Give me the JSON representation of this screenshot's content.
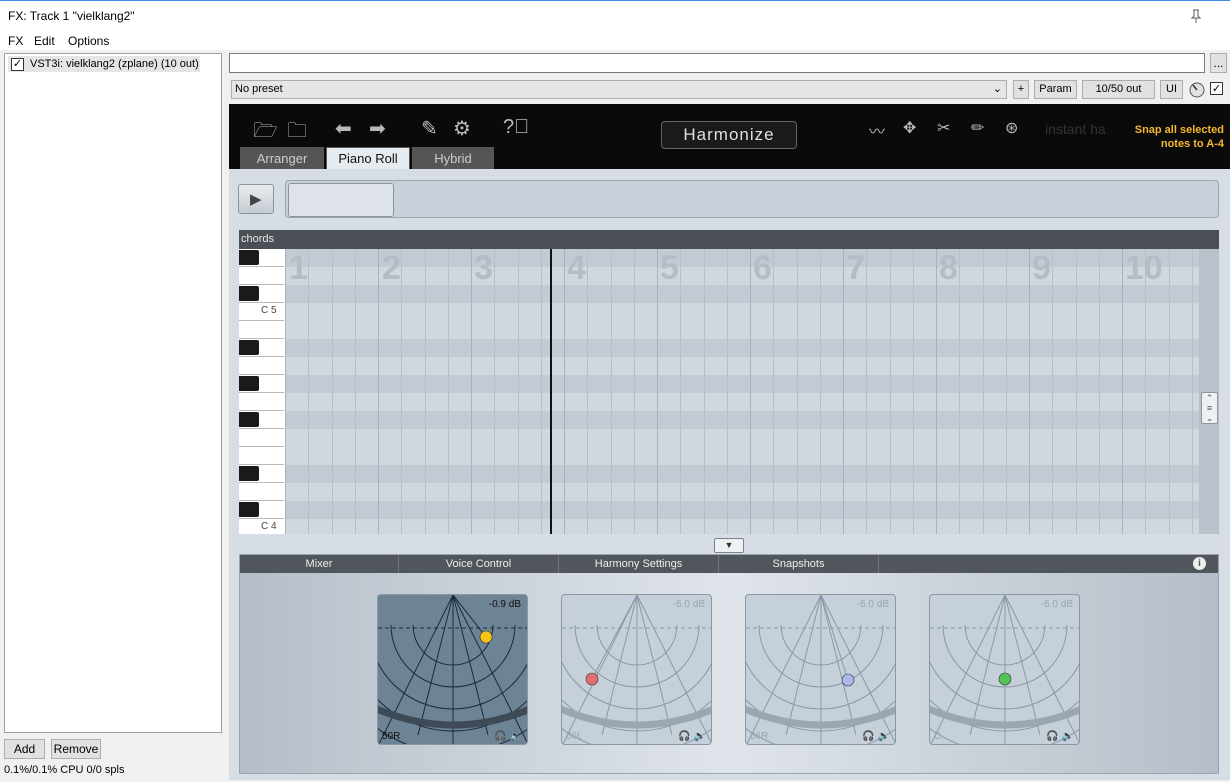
{
  "window": {
    "title": "FX: Track 1 \"vielklang2\""
  },
  "menu": {
    "items": [
      "FX",
      "Edit",
      "Options"
    ]
  },
  "fx_list": {
    "items": [
      {
        "label": "VST3i: vielklang2 (zplane) (10 out)",
        "checked": true
      }
    ],
    "add_label": "Add",
    "remove_label": "Remove",
    "cpu": "0.1%/0.1% CPU 0/0 spls"
  },
  "fx_header": {
    "name_value": "",
    "dots_label": "...",
    "preset_value": "No preset",
    "plus_label": "+",
    "param_label": "Param",
    "io_label": "10/50 out",
    "ui_label": "UI"
  },
  "plugin": {
    "toolbar_icons": [
      "folder-open-icon",
      "folder-save-icon",
      "arrow-left-icon",
      "arrow-right-icon",
      "edit-icon",
      "gear-icon",
      "help-icon"
    ],
    "mode_button": "Harmonize",
    "right_icons": [
      "wave-icon",
      "move-icon",
      "scissors-icon",
      "pencil-icon",
      "globe-icon"
    ],
    "brand_ghost": "instant ha",
    "hint_line1": "Snap all selected",
    "hint_line2": "notes to A-4",
    "hint_color": "#f5b82e",
    "tabs": [
      "Arranger",
      "Piano Roll",
      "Hybrid"
    ],
    "active_tab": "Piano Roll",
    "roll": {
      "track_label": "chords",
      "bars": [
        "1",
        "2",
        "3",
        "4",
        "5",
        "6",
        "7",
        "8",
        "9",
        "10"
      ],
      "key_labels": {
        "c5": "C 5",
        "c4": "C 4"
      }
    },
    "mixer": {
      "tabs": [
        "Mixer",
        "Voice Control",
        "Harmony Settings",
        "Snapshots"
      ],
      "info_label": "i",
      "voices": [
        {
          "db": "-0.9 dB",
          "label": "50R",
          "active": true,
          "dot_color": "#f5c518",
          "icons": "🎧 🔈"
        },
        {
          "db": "-6.0 dB",
          "label": "66L",
          "active": false,
          "dot_color": "#e07070",
          "icons": "🎧 🔈"
        },
        {
          "db": "-6.0 dB",
          "label": "66R",
          "active": false,
          "dot_color": "#a9b9e8",
          "icons": "🎧 🔈"
        },
        {
          "db": "-6.0 dB",
          "label": "C",
          "active": false,
          "dot_color": "#55c255",
          "icons": "🎧 🔈"
        }
      ]
    }
  }
}
